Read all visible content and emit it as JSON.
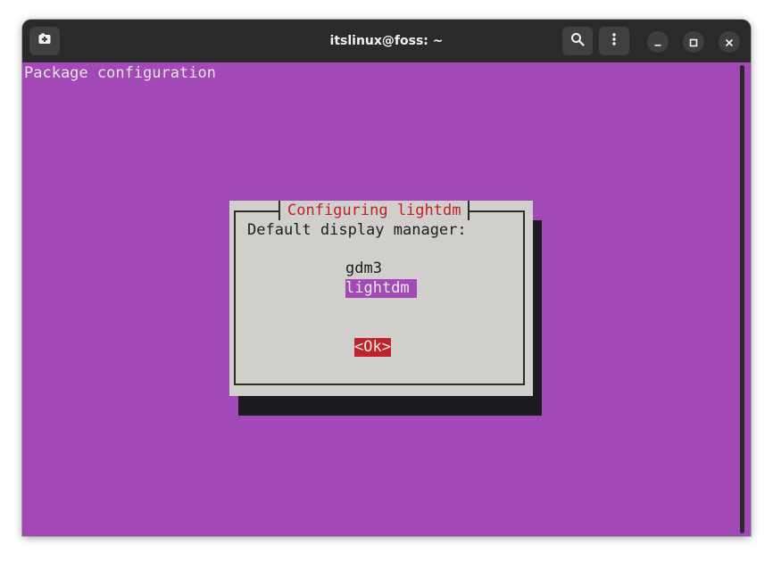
{
  "window": {
    "title": "itslinux@foss: ~"
  },
  "header": {
    "buttons": [
      {
        "name": "new-tab",
        "icon": "new-tab-icon"
      },
      {
        "name": "search",
        "icon": "search-icon"
      },
      {
        "name": "menu",
        "icon": "kebab-menu-icon"
      }
    ],
    "controls": [
      {
        "name": "minimize",
        "icon": "minimize-icon"
      },
      {
        "name": "maximize",
        "icon": "maximize-icon"
      },
      {
        "name": "close",
        "icon": "close-icon"
      }
    ]
  },
  "terminal": {
    "top_title": "Package configuration",
    "background": "#a348b7"
  },
  "dialog": {
    "title": "Configuring lightdm",
    "prompt": "Default display manager:",
    "options": [
      {
        "label": "gdm3",
        "selected": false
      },
      {
        "label": "lightdm",
        "selected": true
      }
    ],
    "ok_label": "<Ok>",
    "colors": {
      "dialog_bg": "#d0cfcc",
      "title_text": "#c0222c",
      "selection_bg": "#a348b7",
      "ok_bg": "#c0222c"
    }
  }
}
